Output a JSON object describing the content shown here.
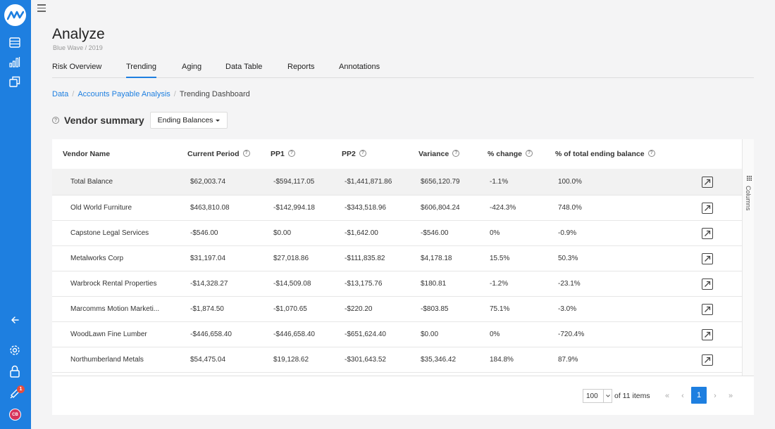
{
  "app": {
    "title": "Analyze",
    "subtitle": "Blue Wave / 2019",
    "accent_color": "#1e7fe0"
  },
  "sidebar": {
    "logo_icon": "logo-icon",
    "icons": [
      "table-icon",
      "chart-icon",
      "stack-icon",
      "arrow-left-icon",
      "gear-icon",
      "lock-icon",
      "rocket-icon"
    ],
    "notification_count": "1",
    "avatar_initials": "CB"
  },
  "tabs": [
    {
      "label": "Risk Overview",
      "active": false
    },
    {
      "label": "Trending",
      "active": true
    },
    {
      "label": "Aging",
      "active": false
    },
    {
      "label": "Data Table",
      "active": false
    },
    {
      "label": "Reports",
      "active": false
    },
    {
      "label": "Annotations",
      "active": false
    }
  ],
  "breadcrumb": {
    "items": [
      "Data",
      "Accounts Payable Analysis"
    ],
    "current": "Trending Dashboard"
  },
  "summary": {
    "title": "Vendor summary",
    "dropdown_value": "Ending Balances"
  },
  "table": {
    "columns": [
      "Vendor Name",
      "Current Period",
      "PP1",
      "PP2",
      "Variance",
      "% change",
      "% of total ending balance"
    ],
    "rows": [
      [
        "Total Balance",
        "$62,003.74",
        "-$594,117.05",
        "-$1,441,871.86",
        "$656,120.79",
        "-1.1%",
        "100.0%"
      ],
      [
        "Old World Furniture",
        "$463,810.08",
        "-$142,994.18",
        "-$343,518.96",
        "$606,804.24",
        "-424.3%",
        "748.0%"
      ],
      [
        "Capstone Legal Services",
        "-$546.00",
        "$0.00",
        "-$1,642.00",
        "-$546.00",
        "0%",
        "-0.9%"
      ],
      [
        "Metalworks Corp",
        "$31,197.04",
        "$27,018.86",
        "-$111,835.82",
        "$4,178.18",
        "15.5%",
        "50.3%"
      ],
      [
        "Warbrock Rental Properties",
        "-$14,328.27",
        "-$14,509.08",
        "-$13,175.76",
        "$180.81",
        "-1.2%",
        "-23.1%"
      ],
      [
        "Marcomms Motion Marketi...",
        "-$1,874.50",
        "-$1,070.65",
        "-$220.20",
        "-$803.85",
        "75.1%",
        "-3.0%"
      ],
      [
        "WoodLawn Fine Lumber",
        "-$446,658.40",
        "-$446,658.40",
        "-$651,624.40",
        "$0.00",
        "0%",
        "-720.4%"
      ],
      [
        "Northumberland Metals",
        "$54,475.04",
        "$19,128.62",
        "-$301,643.52",
        "$35,346.42",
        "184.8%",
        "87.9%"
      ]
    ],
    "columns_panel_label": "Columns"
  },
  "pagination": {
    "page_size": "100",
    "items_label": "of 11 items",
    "first": "«",
    "prev": "‹",
    "current_page": "1",
    "next": "›",
    "last": "»"
  }
}
